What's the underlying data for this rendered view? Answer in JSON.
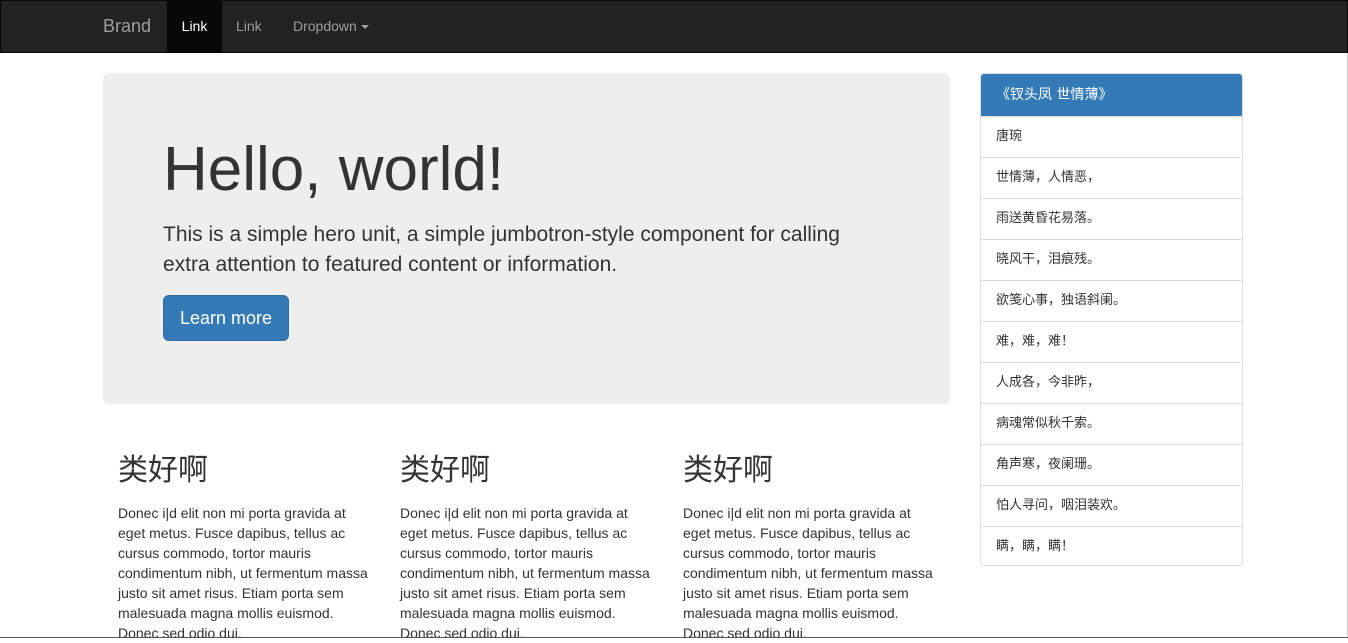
{
  "navbar": {
    "brand": "Brand",
    "items": [
      {
        "label": "Link"
      },
      {
        "label": "Link"
      },
      {
        "label": "Dropdown"
      }
    ]
  },
  "jumbotron": {
    "heading": "Hello, world!",
    "text": "This is a simple hero unit, a simple jumbotron-style component for calling extra attention to featured content or information.",
    "button": "Learn more"
  },
  "columns": [
    {
      "heading": "类好啊",
      "text": "Donec i|d elit non mi porta gravida at eget metus. Fusce dapibus, tellus ac cursus commodo, tortor mauris condimentum nibh, ut fermentum massa justo sit amet risus. Etiam porta sem malesuada magna mollis euismod. Donec sed odio dui."
    },
    {
      "heading": "类好啊",
      "text": "Donec i|d elit non mi porta gravida at eget metus. Fusce dapibus, tellus ac cursus commodo, tortor mauris condimentum nibh, ut fermentum massa justo sit amet risus. Etiam porta sem malesuada magna mollis euismod. Donec sed odio dui."
    },
    {
      "heading": "类好啊",
      "text": "Donec i|d elit non mi porta gravida at eget metus. Fusce dapibus, tellus ac cursus commodo, tortor mauris condimentum nibh, ut fermentum massa justo sit amet risus. Etiam porta sem malesuada magna mollis euismod. Donec sed odio dui."
    }
  ],
  "sidebar": {
    "title": "《钗头凤 世情薄》",
    "items": [
      "唐琬",
      "世情薄，人情恶，",
      "雨送黄昏花易落。",
      "晓风干，泪痕残。",
      "欲笺心事，独语斜阑。",
      "难，难，难！",
      "人成各，今非昨，",
      "病魂常似秋千索。",
      "角声寒，夜阑珊。",
      "怕人寻问，咽泪装欢。",
      "瞒，瞒，瞒！"
    ]
  },
  "colors": {
    "navbar_bg": "#222222",
    "primary": "#337ab7",
    "jumbotron_bg": "#eeeeee"
  }
}
